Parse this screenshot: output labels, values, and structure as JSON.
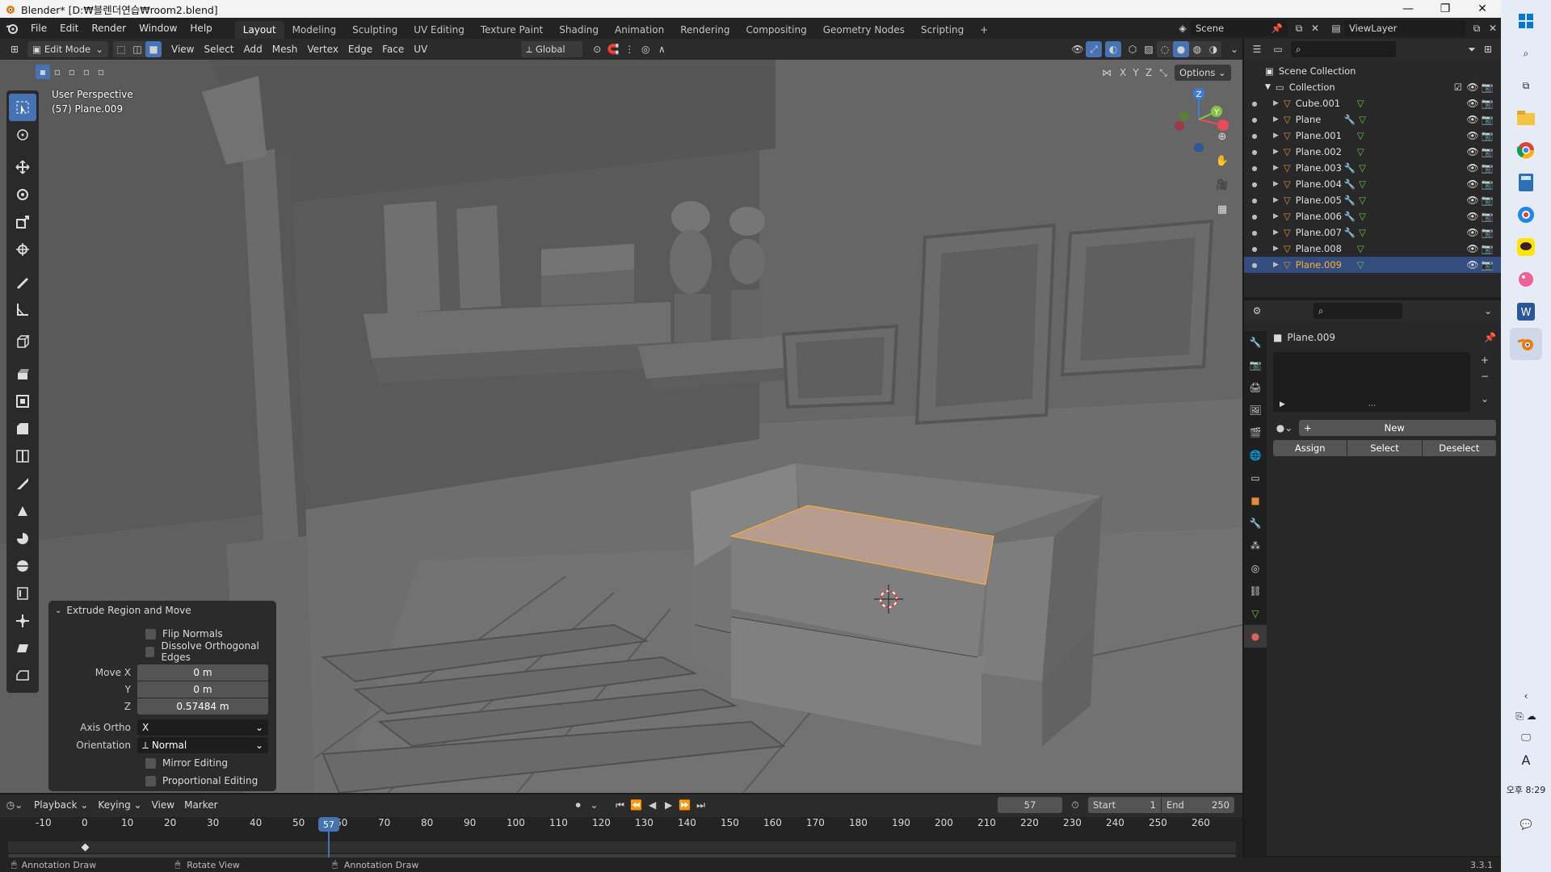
{
  "window": {
    "title": "Blender* [D:₩블렌더연습₩room2.blend]",
    "minimize": "—",
    "maximize": "❐",
    "close": "✕"
  },
  "menu": [
    "File",
    "Edit",
    "Render",
    "Window",
    "Help"
  ],
  "workspaces": {
    "items": [
      "Layout",
      "Modeling",
      "Sculpting",
      "UV Editing",
      "Texture Paint",
      "Shading",
      "Animation",
      "Rendering",
      "Compositing",
      "Geometry Nodes",
      "Scripting"
    ],
    "active": "Layout",
    "add": "+"
  },
  "scene": {
    "name": "Scene",
    "view_layer": "ViewLayer"
  },
  "viewport_header": {
    "mode": "Edit Mode",
    "menus": [
      "View",
      "Select",
      "Add",
      "Mesh",
      "Vertex",
      "Edge",
      "Face",
      "UV"
    ],
    "orientation": "Global",
    "axes": [
      "X",
      "Y",
      "Z"
    ],
    "options": "Options"
  },
  "viewport": {
    "perspective": "User Perspective",
    "object": "(57) Plane.009",
    "face_highlight": "#b89c8e"
  },
  "gizmo": {
    "x": "X",
    "y": "Y",
    "z": "Z",
    "x_color": "#e94a57",
    "y_color": "#8ac43f",
    "z_color": "#3b7fde"
  },
  "tools": [
    "select-box",
    "cursor",
    "move",
    "rotate",
    "scale",
    "transform",
    "annotate",
    "measure",
    "add-cube",
    "extrude-region",
    "inset-faces",
    "bevel",
    "loop-cut",
    "knife",
    "poly-build",
    "spin",
    "smooth",
    "edge-slide",
    "shrink-fatten",
    "shear",
    "rip-region"
  ],
  "redo_panel": {
    "title": "Extrude Region and Move",
    "flip_normals": "Flip Normals",
    "dissolve": "Dissolve Orthogonal Edges",
    "move_x_label": "Move X",
    "move_x": "0 m",
    "y_label": "Y",
    "y": "0 m",
    "z_label": "Z",
    "z": "0.57484 m",
    "axis_ortho_label": "Axis Ortho",
    "axis_ortho": "X",
    "orientation_label": "Orientation",
    "orientation": "Normal",
    "mirror": "Mirror Editing",
    "proportional": "Proportional Editing"
  },
  "outliner": {
    "scene_collection": "Scene Collection",
    "collection": "Collection",
    "objects": [
      {
        "name": "Cube.001",
        "modifier": false
      },
      {
        "name": "Plane",
        "modifier": true
      },
      {
        "name": "Plane.001",
        "modifier": false
      },
      {
        "name": "Plane.002",
        "modifier": false
      },
      {
        "name": "Plane.003",
        "modifier": true
      },
      {
        "name": "Plane.004",
        "modifier": true
      },
      {
        "name": "Plane.005",
        "modifier": true
      },
      {
        "name": "Plane.006",
        "modifier": true
      },
      {
        "name": "Plane.007",
        "modifier": true
      },
      {
        "name": "Plane.008",
        "modifier": false
      },
      {
        "name": "Plane.009",
        "modifier": false,
        "selected": true
      }
    ]
  },
  "properties": {
    "object_name": "Plane.009",
    "new": "New",
    "assign": "Assign",
    "select": "Select",
    "deselect": "Deselect"
  },
  "timeline": {
    "menus": [
      "Playback",
      "Keying",
      "View",
      "Marker"
    ],
    "current_frame": "57",
    "start_label": "Start",
    "start": "1",
    "end_label": "End",
    "end": "250",
    "ticks": [
      "-10",
      "0",
      "10",
      "20",
      "30",
      "40",
      "50",
      "60",
      "70",
      "80",
      "90",
      "100",
      "110",
      "120",
      "130",
      "140",
      "150",
      "160",
      "170",
      "180",
      "190",
      "200",
      "210",
      "220",
      "230",
      "240",
      "250",
      "260"
    ]
  },
  "statusbar": {
    "left": "Annotation Draw",
    "middle": "Rotate View",
    "right": "Annotation Draw",
    "version": "3.3.1"
  },
  "taskbar": {
    "time": "오후 8:29",
    "ime": "A"
  }
}
